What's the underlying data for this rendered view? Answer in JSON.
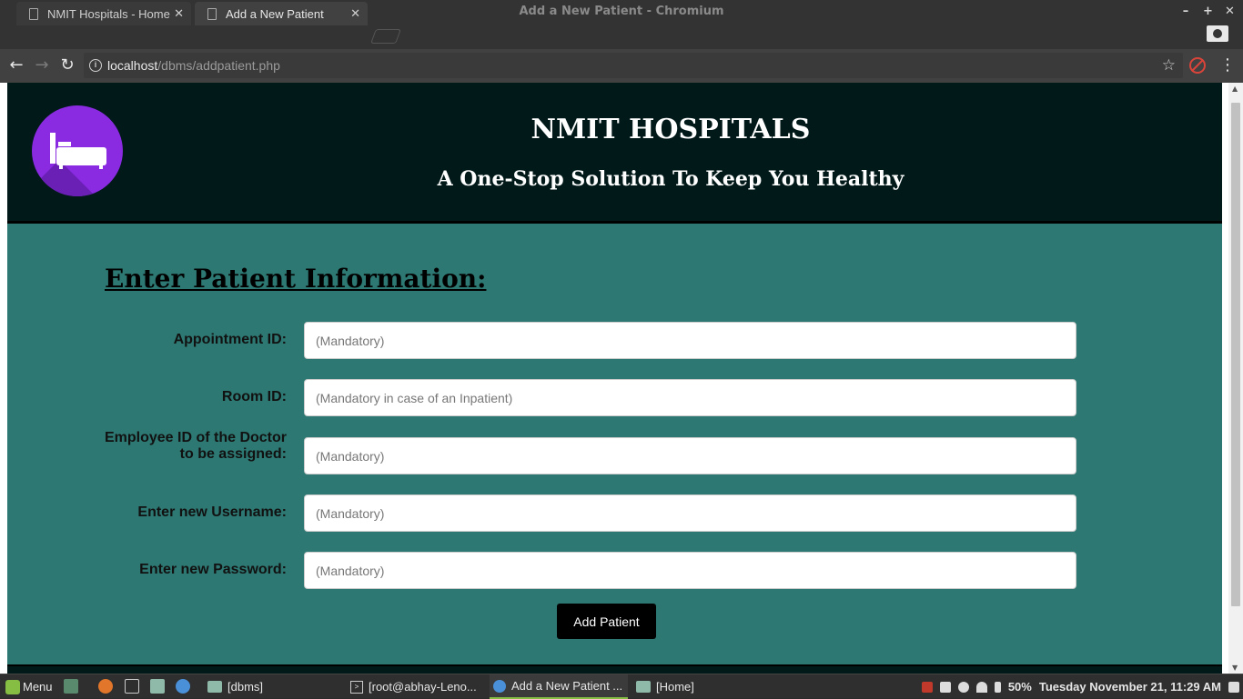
{
  "window": {
    "title": "Add a New Patient - Chromium",
    "controls": [
      "–",
      "+",
      "✕"
    ]
  },
  "tabs": [
    {
      "label": "NMIT Hospitals - Home",
      "close": "✕"
    },
    {
      "label": "Add a New Patient",
      "close": "✕"
    }
  ],
  "toolbar": {
    "back": "←",
    "forward": "→",
    "reload": "↻",
    "url_host": "localhost",
    "url_path": "/dbms/addpatient.php",
    "info": "i",
    "star": "☆",
    "menu": "⋮"
  },
  "header": {
    "title": "NMIT HOSPITALS",
    "tagline": "A One-Stop Solution To Keep You Healthy",
    "logo_icon": "hospital-bed-icon"
  },
  "form": {
    "heading": "Enter Patient Information:",
    "fields": [
      {
        "label": "Appointment ID:",
        "placeholder": "(Mandatory)"
      },
      {
        "label": "Room ID:",
        "placeholder": "(Mandatory in case of an Inpatient)"
      },
      {
        "label": "Employee ID of the Doctor to be assigned:",
        "placeholder": "(Mandatory)"
      },
      {
        "label": "Enter new Username:",
        "placeholder": "(Mandatory)"
      },
      {
        "label": "Enter new Password:",
        "placeholder": "(Mandatory)"
      }
    ],
    "submit_label": "Add Patient"
  },
  "taskbar": {
    "menu_label": "Menu",
    "windows": [
      {
        "label": "[dbms]",
        "icon": "folder-icon"
      },
      {
        "label": "[root@abhay-Leno...",
        "icon": "terminal-icon"
      },
      {
        "label": "Add a New Patient ...",
        "icon": "chromium-icon"
      },
      {
        "label": "[Home]",
        "icon": "folder-icon"
      }
    ],
    "battery": "50%",
    "clock": "Tuesday November 21, 11:29 AM"
  },
  "colors": {
    "header_bg": "#02191a",
    "main_bg": "#2d7872",
    "logo_bg": "#8a2be2",
    "button_bg": "#000000"
  }
}
